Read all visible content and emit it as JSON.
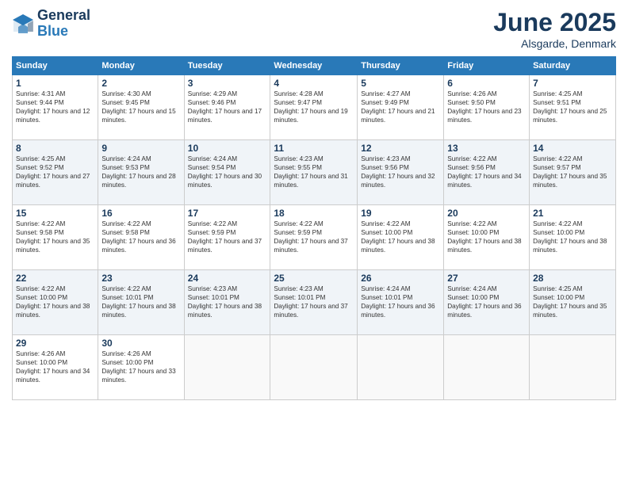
{
  "header": {
    "logo_line1": "General",
    "logo_line2": "Blue",
    "month": "June 2025",
    "location": "Alsgarde, Denmark"
  },
  "weekdays": [
    "Sunday",
    "Monday",
    "Tuesday",
    "Wednesday",
    "Thursday",
    "Friday",
    "Saturday"
  ],
  "weeks": [
    [
      {
        "day": "1",
        "rise": "Sunrise: 4:31 AM",
        "set": "Sunset: 9:44 PM",
        "daylight": "Daylight: 17 hours and 12 minutes."
      },
      {
        "day": "2",
        "rise": "Sunrise: 4:30 AM",
        "set": "Sunset: 9:45 PM",
        "daylight": "Daylight: 17 hours and 15 minutes."
      },
      {
        "day": "3",
        "rise": "Sunrise: 4:29 AM",
        "set": "Sunset: 9:46 PM",
        "daylight": "Daylight: 17 hours and 17 minutes."
      },
      {
        "day": "4",
        "rise": "Sunrise: 4:28 AM",
        "set": "Sunset: 9:47 PM",
        "daylight": "Daylight: 17 hours and 19 minutes."
      },
      {
        "day": "5",
        "rise": "Sunrise: 4:27 AM",
        "set": "Sunset: 9:49 PM",
        "daylight": "Daylight: 17 hours and 21 minutes."
      },
      {
        "day": "6",
        "rise": "Sunrise: 4:26 AM",
        "set": "Sunset: 9:50 PM",
        "daylight": "Daylight: 17 hours and 23 minutes."
      },
      {
        "day": "7",
        "rise": "Sunrise: 4:25 AM",
        "set": "Sunset: 9:51 PM",
        "daylight": "Daylight: 17 hours and 25 minutes."
      }
    ],
    [
      {
        "day": "8",
        "rise": "Sunrise: 4:25 AM",
        "set": "Sunset: 9:52 PM",
        "daylight": "Daylight: 17 hours and 27 minutes."
      },
      {
        "day": "9",
        "rise": "Sunrise: 4:24 AM",
        "set": "Sunset: 9:53 PM",
        "daylight": "Daylight: 17 hours and 28 minutes."
      },
      {
        "day": "10",
        "rise": "Sunrise: 4:24 AM",
        "set": "Sunset: 9:54 PM",
        "daylight": "Daylight: 17 hours and 30 minutes."
      },
      {
        "day": "11",
        "rise": "Sunrise: 4:23 AM",
        "set": "Sunset: 9:55 PM",
        "daylight": "Daylight: 17 hours and 31 minutes."
      },
      {
        "day": "12",
        "rise": "Sunrise: 4:23 AM",
        "set": "Sunset: 9:56 PM",
        "daylight": "Daylight: 17 hours and 32 minutes."
      },
      {
        "day": "13",
        "rise": "Sunrise: 4:22 AM",
        "set": "Sunset: 9:56 PM",
        "daylight": "Daylight: 17 hours and 34 minutes."
      },
      {
        "day": "14",
        "rise": "Sunrise: 4:22 AM",
        "set": "Sunset: 9:57 PM",
        "daylight": "Daylight: 17 hours and 35 minutes."
      }
    ],
    [
      {
        "day": "15",
        "rise": "Sunrise: 4:22 AM",
        "set": "Sunset: 9:58 PM",
        "daylight": "Daylight: 17 hours and 35 minutes."
      },
      {
        "day": "16",
        "rise": "Sunrise: 4:22 AM",
        "set": "Sunset: 9:58 PM",
        "daylight": "Daylight: 17 hours and 36 minutes."
      },
      {
        "day": "17",
        "rise": "Sunrise: 4:22 AM",
        "set": "Sunset: 9:59 PM",
        "daylight": "Daylight: 17 hours and 37 minutes."
      },
      {
        "day": "18",
        "rise": "Sunrise: 4:22 AM",
        "set": "Sunset: 9:59 PM",
        "daylight": "Daylight: 17 hours and 37 minutes."
      },
      {
        "day": "19",
        "rise": "Sunrise: 4:22 AM",
        "set": "Sunset: 10:00 PM",
        "daylight": "Daylight: 17 hours and 38 minutes."
      },
      {
        "day": "20",
        "rise": "Sunrise: 4:22 AM",
        "set": "Sunset: 10:00 PM",
        "daylight": "Daylight: 17 hours and 38 minutes."
      },
      {
        "day": "21",
        "rise": "Sunrise: 4:22 AM",
        "set": "Sunset: 10:00 PM",
        "daylight": "Daylight: 17 hours and 38 minutes."
      }
    ],
    [
      {
        "day": "22",
        "rise": "Sunrise: 4:22 AM",
        "set": "Sunset: 10:00 PM",
        "daylight": "Daylight: 17 hours and 38 minutes."
      },
      {
        "day": "23",
        "rise": "Sunrise: 4:22 AM",
        "set": "Sunset: 10:01 PM",
        "daylight": "Daylight: 17 hours and 38 minutes."
      },
      {
        "day": "24",
        "rise": "Sunrise: 4:23 AM",
        "set": "Sunset: 10:01 PM",
        "daylight": "Daylight: 17 hours and 38 minutes."
      },
      {
        "day": "25",
        "rise": "Sunrise: 4:23 AM",
        "set": "Sunset: 10:01 PM",
        "daylight": "Daylight: 17 hours and 37 minutes."
      },
      {
        "day": "26",
        "rise": "Sunrise: 4:24 AM",
        "set": "Sunset: 10:01 PM",
        "daylight": "Daylight: 17 hours and 36 minutes."
      },
      {
        "day": "27",
        "rise": "Sunrise: 4:24 AM",
        "set": "Sunset: 10:00 PM",
        "daylight": "Daylight: 17 hours and 36 minutes."
      },
      {
        "day": "28",
        "rise": "Sunrise: 4:25 AM",
        "set": "Sunset: 10:00 PM",
        "daylight": "Daylight: 17 hours and 35 minutes."
      }
    ],
    [
      {
        "day": "29",
        "rise": "Sunrise: 4:26 AM",
        "set": "Sunset: 10:00 PM",
        "daylight": "Daylight: 17 hours and 34 minutes."
      },
      {
        "day": "30",
        "rise": "Sunrise: 4:26 AM",
        "set": "Sunset: 10:00 PM",
        "daylight": "Daylight: 17 hours and 33 minutes."
      },
      null,
      null,
      null,
      null,
      null
    ]
  ]
}
